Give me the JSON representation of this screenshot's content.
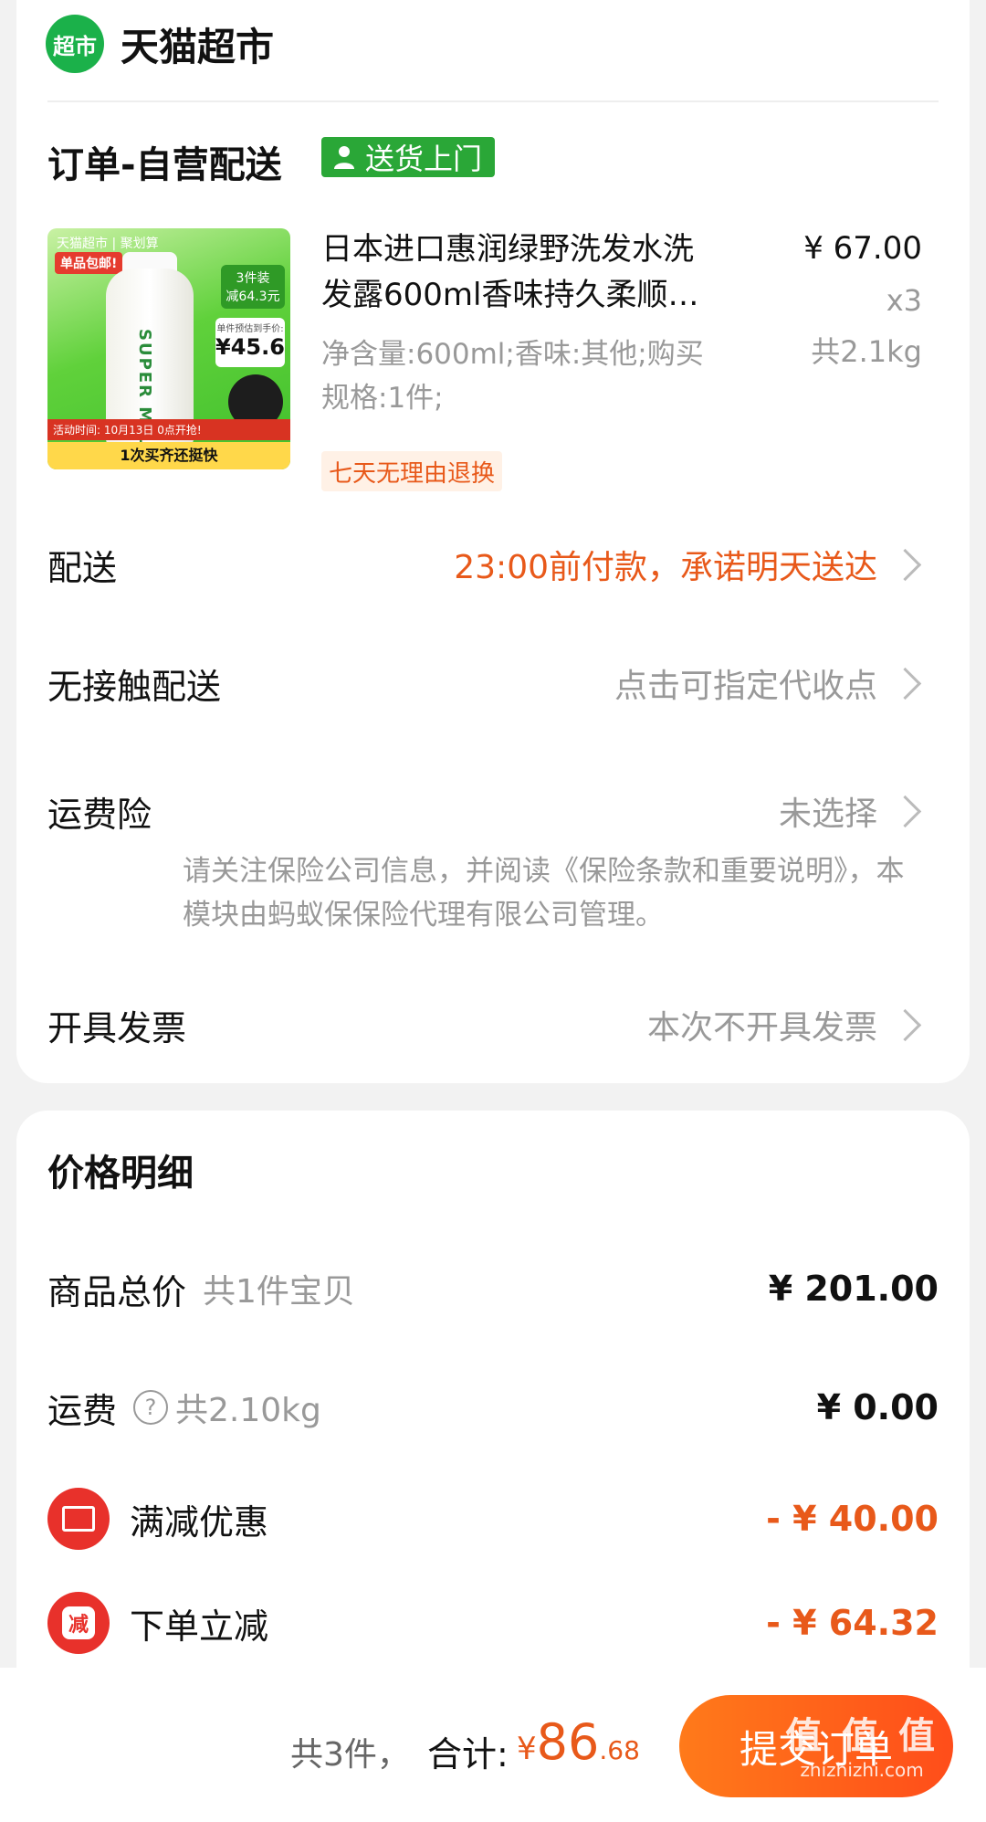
{
  "store": {
    "logo_text": "超市",
    "name": "天猫超市"
  },
  "order": {
    "title": "订单-自营配送",
    "ship_tag": "送货上门"
  },
  "product": {
    "title_line1": "日本进口惠润绿野洗发水洗",
    "title_line2": "发露600ml香味持久柔顺…",
    "spec_line1": "净含量:600ml;香味:其他;购买",
    "spec_line2": "规格:1件;",
    "price": "¥ 67.00",
    "qty": "x3",
    "weight": "共2.1kg",
    "return_tag": "七天无理由退换",
    "thumb": {
      "top_text": "天猫超市 | 聚划算",
      "free_ship": "单品包邮!",
      "badge_line1": "3件装",
      "badge_line2": "减64.3元",
      "price_caption": "单件预估到手价:",
      "price_value": "¥45.6",
      "brand": "SUPER MILD",
      "event_time": "活动时间: 10月13日 0点开抢!",
      "bottom_text": "1次买齐还挺快"
    }
  },
  "rows": {
    "delivery": {
      "label": "配送",
      "value": "23:00前付款，承诺明天送达"
    },
    "contactless": {
      "label": "无接触配送",
      "value": "点击可指定代收点"
    },
    "insurance": {
      "label": "运费险",
      "value": "未选择",
      "note": "请关注保险公司信息，并阅读《保险条款和重要说明》，本模块由蚂蚁保保险代理有限公司管理。"
    },
    "invoice": {
      "label": "开具发票",
      "value": "本次不开具发票"
    }
  },
  "price_detail": {
    "title": "价格明细",
    "goods_total": {
      "label": "商品总价",
      "sub": "共1件宝贝",
      "amount": "¥ 201.00"
    },
    "shipping": {
      "label": "运费",
      "sub": "共2.10kg",
      "amount": "¥ 0.00"
    },
    "full_discount": {
      "label": "满减优惠",
      "amount": "- ¥ 40.00"
    },
    "order_discount": {
      "label": "下单立减",
      "amount": "- ¥ 64.32",
      "icon_text": "减"
    }
  },
  "bottom": {
    "count": "共3件，",
    "total_label": "合计:",
    "currency": "¥",
    "total_int": "86",
    "total_dec": ".68",
    "submit": "提交订单",
    "watermark": "值 值 值",
    "watermark_site": "zhizhizhi.com"
  },
  "colors": {
    "green": "#1bb14a",
    "orange": "#e8591a",
    "red": "#e8312b"
  }
}
